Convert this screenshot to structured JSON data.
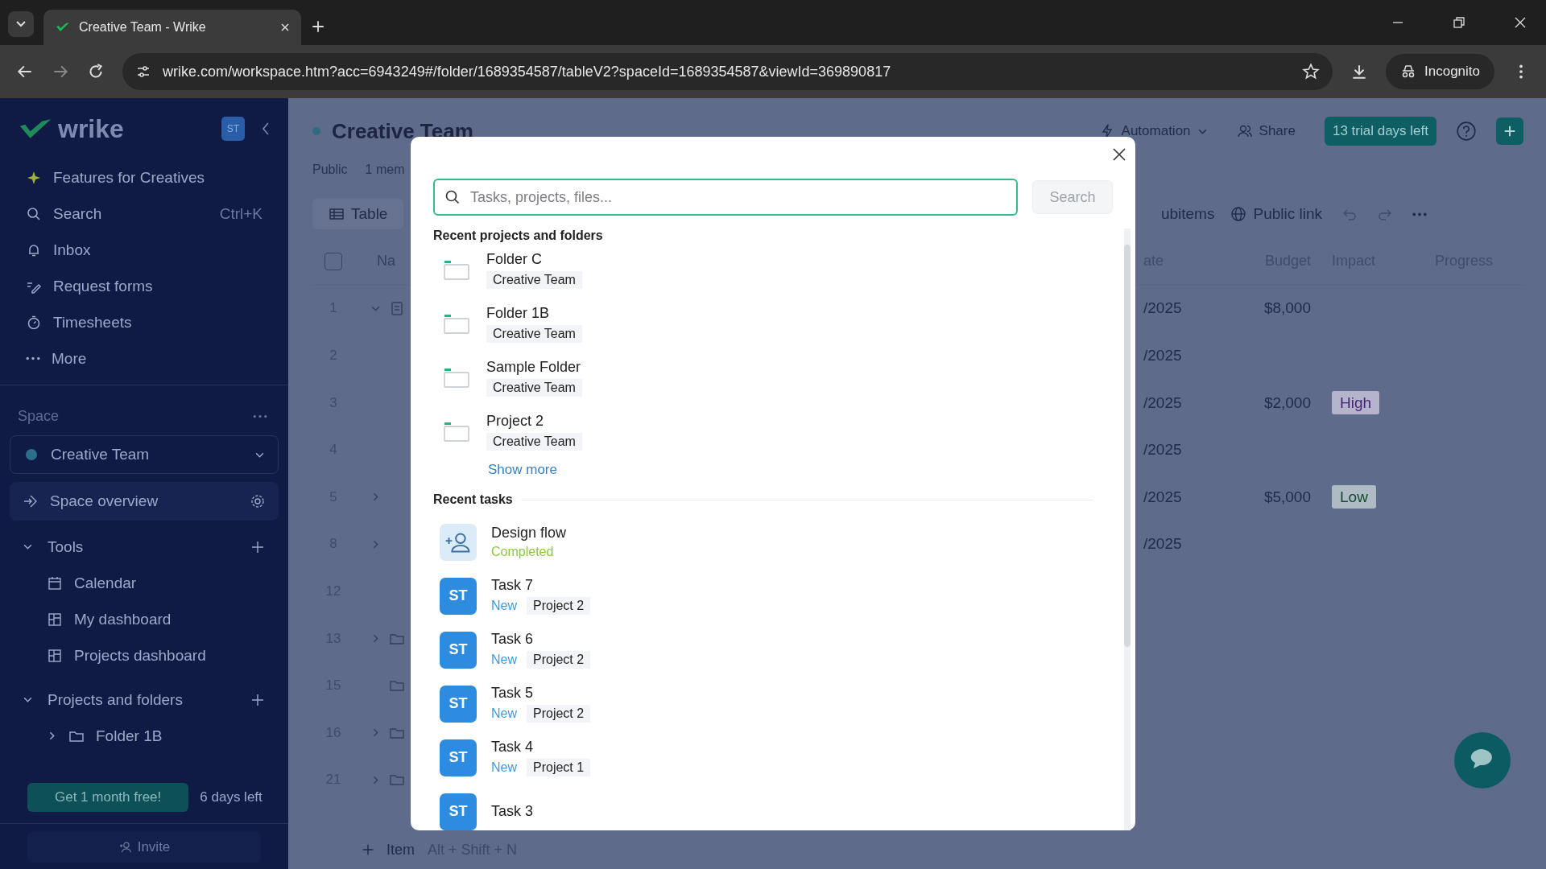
{
  "browser": {
    "tab_title": "Creative Team - Wrike",
    "url": "wrike.com/workspace.htm?acc=6943249#/folder/1689354587/tableV2?spaceId=1689354587&viewId=369890817",
    "profile": "Incognito"
  },
  "sidebar": {
    "logo": "wrike",
    "avatar": "ST",
    "shortcut": "Ctrl+K",
    "nav": [
      {
        "label": "Features for Creatives"
      },
      {
        "label": "Search"
      },
      {
        "label": "Inbox"
      },
      {
        "label": "Request forms"
      },
      {
        "label": "Timesheets"
      },
      {
        "label": "More"
      }
    ],
    "space_label": "Space",
    "space": "Creative Team",
    "space_overview": "Space overview",
    "tools": {
      "label": "Tools",
      "expanded": true,
      "items": [
        {
          "label": "Calendar"
        },
        {
          "label": "My dashboard"
        },
        {
          "label": "Projects dashboard"
        }
      ]
    },
    "projects": {
      "label": "Projects and folders",
      "expanded": true,
      "items": [
        {
          "label": "Folder 1B",
          "expanded": false
        }
      ]
    },
    "promo_button": "Get 1 month free!",
    "days_left": "6 days left",
    "invite": "Invite"
  },
  "header": {
    "title": "Creative Team",
    "visibility": "Public",
    "members": "1 mem",
    "automation": "Automation",
    "share": "Share",
    "trial": "13 trial days left"
  },
  "toolbar": {
    "view_tab": "Table",
    "subitems": "ubitems",
    "public_link": "Public link"
  },
  "table": {
    "select_all_checked": false,
    "columns": [
      "Na",
      "ate",
      "Budget",
      "Impact",
      "Progress"
    ],
    "rows": [
      {
        "number": "1",
        "kind": "task",
        "has_children": true,
        "expanded": true,
        "date": "/2025",
        "budget": "$8,000"
      },
      {
        "number": "2",
        "kind": "plain",
        "has_children": false,
        "date": "/2025"
      },
      {
        "number": "3",
        "kind": "plain",
        "has_children": false,
        "date": "/2025",
        "budget": "$2,000",
        "impact": {
          "label": "High",
          "color": "#4a1f78"
        }
      },
      {
        "number": "4",
        "kind": "plain",
        "has_children": false,
        "date": "/2025"
      },
      {
        "number": "5",
        "kind": "plain",
        "has_children": true,
        "expanded": false,
        "date": "/2025",
        "budget": "$5,000",
        "impact": {
          "label": "Low",
          "color": "#174a30"
        }
      },
      {
        "number": "8",
        "kind": "plain",
        "has_children": true,
        "expanded": false,
        "date": "/2025"
      },
      {
        "number": "12",
        "kind": "plain",
        "has_children": false
      },
      {
        "number": "13",
        "kind": "folder",
        "has_children": true,
        "expanded": false
      },
      {
        "number": "15",
        "kind": "folder",
        "has_children": false
      },
      {
        "number": "16",
        "kind": "folder",
        "has_children": true,
        "expanded": false
      },
      {
        "number": "21",
        "kind": "folder",
        "has_children": true,
        "expanded": false
      }
    ]
  },
  "add_item": {
    "label": "Item",
    "shortcut": "Alt + Shift + N"
  },
  "search_modal": {
    "placeholder": "Tasks, projects, files...",
    "button": "Search",
    "projects_heading": "Recent projects and folders",
    "projects": [
      {
        "name": "Folder C",
        "space": "Creative Team"
      },
      {
        "name": "Folder 1B",
        "space": "Creative Team"
      },
      {
        "name": "Sample Folder",
        "space": "Creative Team"
      },
      {
        "name": "Project 2",
        "space": "Creative Team"
      }
    ],
    "show_more": "Show more",
    "tasks_heading": "Recent tasks",
    "tasks": [
      {
        "kind": "assign",
        "title": "Design flow",
        "status": {
          "label": "Completed",
          "color": "#8cc63f"
        }
      },
      {
        "kind": "avatar",
        "avatar": "ST",
        "title": "Task 7",
        "status": {
          "label": "New",
          "color": "#3d9be0"
        },
        "project": "Project 2"
      },
      {
        "kind": "avatar",
        "avatar": "ST",
        "title": "Task 6",
        "status": {
          "label": "New",
          "color": "#3d9be0"
        },
        "project": "Project 2"
      },
      {
        "kind": "avatar",
        "avatar": "ST",
        "title": "Task 5",
        "status": {
          "label": "New",
          "color": "#3d9be0"
        },
        "project": "Project 2"
      },
      {
        "kind": "avatar",
        "avatar": "ST",
        "title": "Task 4",
        "status": {
          "label": "New",
          "color": "#3d9be0"
        },
        "project": "Project 1"
      },
      {
        "kind": "avatar",
        "avatar": "ST",
        "title": "Task 3"
      }
    ]
  }
}
